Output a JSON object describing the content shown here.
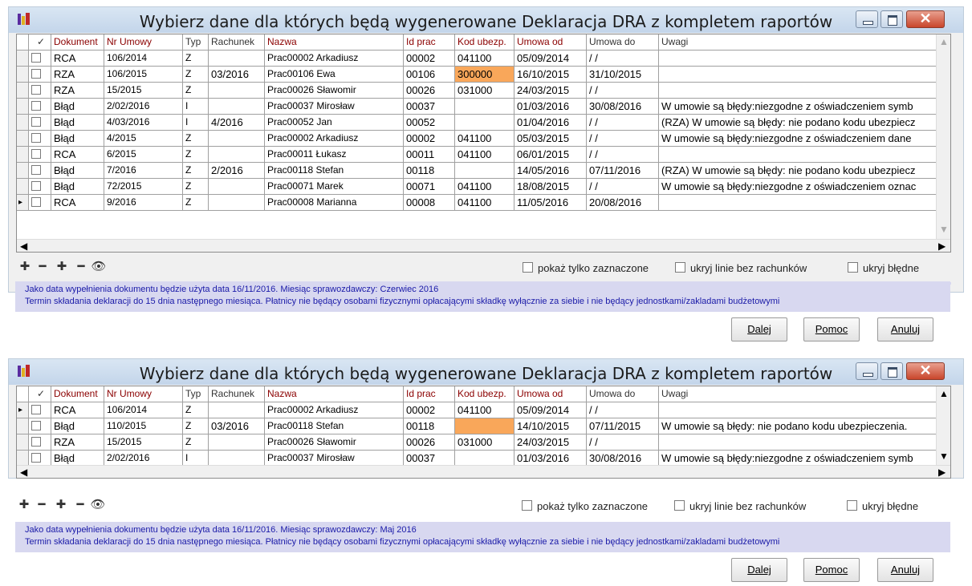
{
  "dialogs": [
    {
      "title": "Wybierz dane dla których będą wygenerowane Deklaracja DRA z kompletem raportów",
      "columns": [
        "✓",
        "Dokument",
        "Nr Umowy",
        "Typ",
        "Rachunek",
        "Nazwa",
        "Id prac",
        "Kod ubezp.",
        "Umowa od",
        "Umowa do",
        "Uwagi"
      ],
      "rows": [
        {
          "doc": "RCA",
          "nr": "106/2014",
          "typ": "Z",
          "rach": "",
          "nazwa": "Prac00002 Arkadiusz",
          "id": "00002",
          "kod": "041100",
          "od": "05/09/2014",
          "do": "/ /",
          "uwagi": ""
        },
        {
          "doc": "RZA",
          "nr": "106/2015",
          "typ": "Z",
          "rach": "03/2016",
          "nazwa": "Prac00106 Ewa",
          "id": "00106",
          "kod": "300000",
          "od": "16/10/2015",
          "do": "31/10/2015",
          "uwagi": ""
        },
        {
          "doc": "RZA",
          "nr": "15/2015",
          "typ": "Z",
          "rach": "",
          "nazwa": "Prac00026 Sławomir",
          "id": "00026",
          "kod": "031000",
          "od": "24/03/2015",
          "do": "/ /",
          "uwagi": ""
        },
        {
          "doc": "Błąd",
          "nr": "2/02/2016",
          "typ": "I",
          "rach": "",
          "nazwa": "Prac00037 Mirosław",
          "id": "00037",
          "kod": "",
          "od": "01/03/2016",
          "do": "30/08/2016",
          "uwagi": " W umowie są błędy:niezgodne z oświadczeniem symb"
        },
        {
          "doc": "Błąd",
          "nr": "4/03/2016",
          "typ": "I",
          "rach": "4/2016",
          "nazwa": "Prac00052 Jan",
          "id": "00052",
          "kod": "",
          "od": "01/04/2016",
          "do": "/ /",
          "uwagi": "(RZA)  W umowie są błędy: nie podano kodu ubezpiecz"
        },
        {
          "doc": "Błąd",
          "nr": "4/2015",
          "typ": "Z",
          "rach": "",
          "nazwa": "Prac00002 Arkadiusz",
          "id": "00002",
          "kod": "041100",
          "od": "05/03/2015",
          "do": "/ /",
          "uwagi": " W umowie są błędy:niezgodne z oświadczeniem dane"
        },
        {
          "doc": "RCA",
          "nr": "6/2015",
          "typ": "Z",
          "rach": "",
          "nazwa": "Prac00011 Łukasz",
          "id": "00011",
          "kod": "041100",
          "od": "06/01/2015",
          "do": "/ /",
          "uwagi": ""
        },
        {
          "doc": "Błąd",
          "nr": "7/2016",
          "typ": "Z",
          "rach": "2/2016",
          "nazwa": "Prac00118 Stefan",
          "id": "00118",
          "kod": "",
          "od": "14/05/2016",
          "do": "07/11/2016",
          "uwagi": "(RZA)  W umowie są błędy: nie podano kodu ubezpiecz"
        },
        {
          "doc": "Błąd",
          "nr": "72/2015",
          "typ": "Z",
          "rach": "",
          "nazwa": "Prac00071 Marek",
          "id": "00071",
          "kod": "041100",
          "od": "18/08/2015",
          "do": "/ /",
          "uwagi": " W umowie są błędy:niezgodne z oświadczeniem oznac"
        },
        {
          "doc": "RCA",
          "nr": "9/2016",
          "typ": "Z",
          "rach": "",
          "nazwa": "Prac00008 Marianna",
          "id": "00008",
          "kod": "041100",
          "od": "11/05/2016",
          "do": "20/08/2016",
          "uwagi": ""
        }
      ],
      "options": [
        "pokaż tylko zaznaczone",
        "ukryj linie bez rachunków",
        "ukryj błędne"
      ],
      "info": [
        "Jako data wypełnienia dokumentu będzie użyta data 16/11/2016.  Miesiąc sprawozdawczy: Czerwiec 2016",
        "Termin składania deklaracji do 15 dnia następnego miesiąca. Płatnicy nie będący osobami fizycznymi opłacającymi składkę wyłącznie za siebie i nie będący jednostkami/zakladami budżetowymi"
      ],
      "buttons": [
        "Dalej",
        "Pomoc",
        "Anuluj"
      ]
    },
    {
      "title": "Wybierz dane dla których będą wygenerowane Deklaracja DRA z kompletem raportów",
      "columns": [
        "✓",
        "Dokument",
        "Nr Umowy",
        "Typ",
        "Rachunek",
        "Nazwa",
        "Id prac",
        "Kod ubezp.",
        "Umowa od",
        "Umowa do",
        "Uwagi"
      ],
      "rows": [
        {
          "doc": "RCA",
          "nr": "106/2014",
          "typ": "Z",
          "rach": "",
          "nazwa": "Prac00002 Arkadiusz",
          "id": "00002",
          "kod": "041100",
          "od": "05/09/2014",
          "do": "/ /",
          "uwagi": ""
        },
        {
          "doc": "Błąd",
          "nr": "110/2015",
          "typ": "Z",
          "rach": "03/2016",
          "nazwa": "Prac00118 Stefan",
          "id": "00118",
          "kod": "",
          "od": "14/10/2015",
          "do": "07/11/2015",
          "uwagi": " W umowie są błędy: nie podano kodu ubezpieczenia."
        },
        {
          "doc": "RZA",
          "nr": "15/2015",
          "typ": "Z",
          "rach": "",
          "nazwa": "Prac00026 Sławomir",
          "id": "00026",
          "kod": "031000",
          "od": "24/03/2015",
          "do": "/ /",
          "uwagi": ""
        },
        {
          "doc": "Błąd",
          "nr": "2/02/2016",
          "typ": "I",
          "rach": "",
          "nazwa": "Prac00037 Mirosław",
          "id": "00037",
          "kod": "",
          "od": "01/03/2016",
          "do": "30/08/2016",
          "uwagi": " W umowie są błędy:niezgodne z oświadczeniem symb"
        }
      ],
      "options": [
        "pokaż tylko zaznaczone",
        "ukryj linie bez rachunków",
        "ukryj błędne"
      ],
      "info": [
        "Jako data wypełnienia dokumentu będzie użyta data 16/11/2016.  Miesiąc sprawozdawczy: Maj 2016",
        "Termin składania deklaracji do 15 dnia następnego miesiąca. Płatnicy nie będący osobami fizycznymi opłacającymi składkę wyłącznie za siebie i nie będący jednostkami/zakladami budżetowymi"
      ],
      "buttons": [
        "Dalej",
        "Pomoc",
        "Anuluj"
      ]
    }
  ],
  "colors": {
    "highlight_orange": "#f9a75a",
    "header_text": "#8b0000",
    "info_text": "#1a1aa8",
    "info_bg": "#d8d8f0"
  },
  "icons": [
    "add-icon",
    "remove-icon",
    "add-all-icon",
    "remove-all-icon",
    "binoculars-icon"
  ]
}
